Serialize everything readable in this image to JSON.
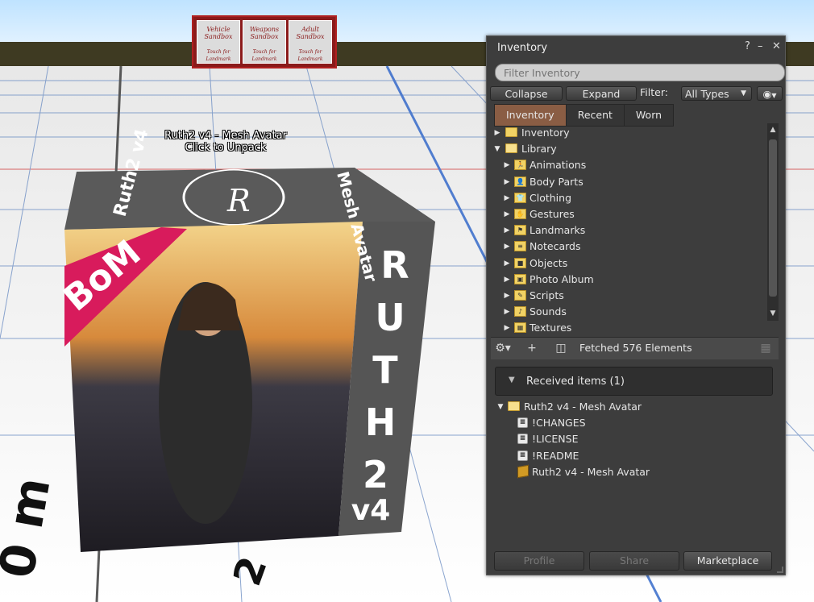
{
  "world": {
    "hover_text_line1": "Ruth2 v4 - Mesh Avatar",
    "hover_text_line2": "Click to Unpack",
    "sandbox_signs": [
      {
        "title": "Vehicle Sandbox",
        "subtitle": "Touch for Landmark"
      },
      {
        "title": "Weapons Sandbox",
        "subtitle": "Touch for Landmark"
      },
      {
        "title": "Adult Sandbox",
        "subtitle": "Touch for Landmark"
      }
    ],
    "box": {
      "badge": "BoM",
      "side_letters": [
        "R",
        "U",
        "T",
        "H",
        "2",
        "v4"
      ],
      "top_text_left": "Ruth2 v4",
      "top_text_right": "Mesh Avatar",
      "top_monogram": "R"
    }
  },
  "inventory": {
    "title": "Inventory",
    "help_icon": "?",
    "filter_placeholder": "Filter Inventory",
    "collapse_label": "Collapse",
    "expand_label": "Expand",
    "filter_label": "Filter:",
    "filter_type": "All Types",
    "tabs": [
      "Inventory",
      "Recent",
      "Worn"
    ],
    "root_items": [
      {
        "label": "Inventory",
        "expanded": false
      },
      {
        "label": "Library",
        "expanded": true
      }
    ],
    "library_items": [
      {
        "label": "Animations",
        "glyph": "🏃"
      },
      {
        "label": "Body Parts",
        "glyph": "👤"
      },
      {
        "label": "Clothing",
        "glyph": "👕"
      },
      {
        "label": "Gestures",
        "glyph": "✋"
      },
      {
        "label": "Landmarks",
        "glyph": "⚑"
      },
      {
        "label": "Notecards",
        "glyph": "≡"
      },
      {
        "label": "Objects",
        "glyph": "■"
      },
      {
        "label": "Photo Album",
        "glyph": "▣"
      },
      {
        "label": "Scripts",
        "glyph": "✎"
      },
      {
        "label": "Sounds",
        "glyph": "♪"
      },
      {
        "label": "Textures",
        "glyph": "▦"
      }
    ],
    "status": "Fetched 576 Elements",
    "received_header": "Received items (1)",
    "received_folder": "Ruth2 v4 - Mesh Avatar",
    "received_items": [
      {
        "label": "!CHANGES",
        "kind": "notecard"
      },
      {
        "label": "!LICENSE",
        "kind": "notecard"
      },
      {
        "label": "!README",
        "kind": "notecard"
      },
      {
        "label": "Ruth2 v4 - Mesh Avatar",
        "kind": "object"
      }
    ],
    "footer": {
      "profile": "Profile",
      "share": "Share",
      "marketplace": "Marketplace"
    },
    "colors": {
      "panel_bg": "#3d3d3d",
      "active_tab": "#8a5d44",
      "folder": "#f1d264"
    }
  }
}
